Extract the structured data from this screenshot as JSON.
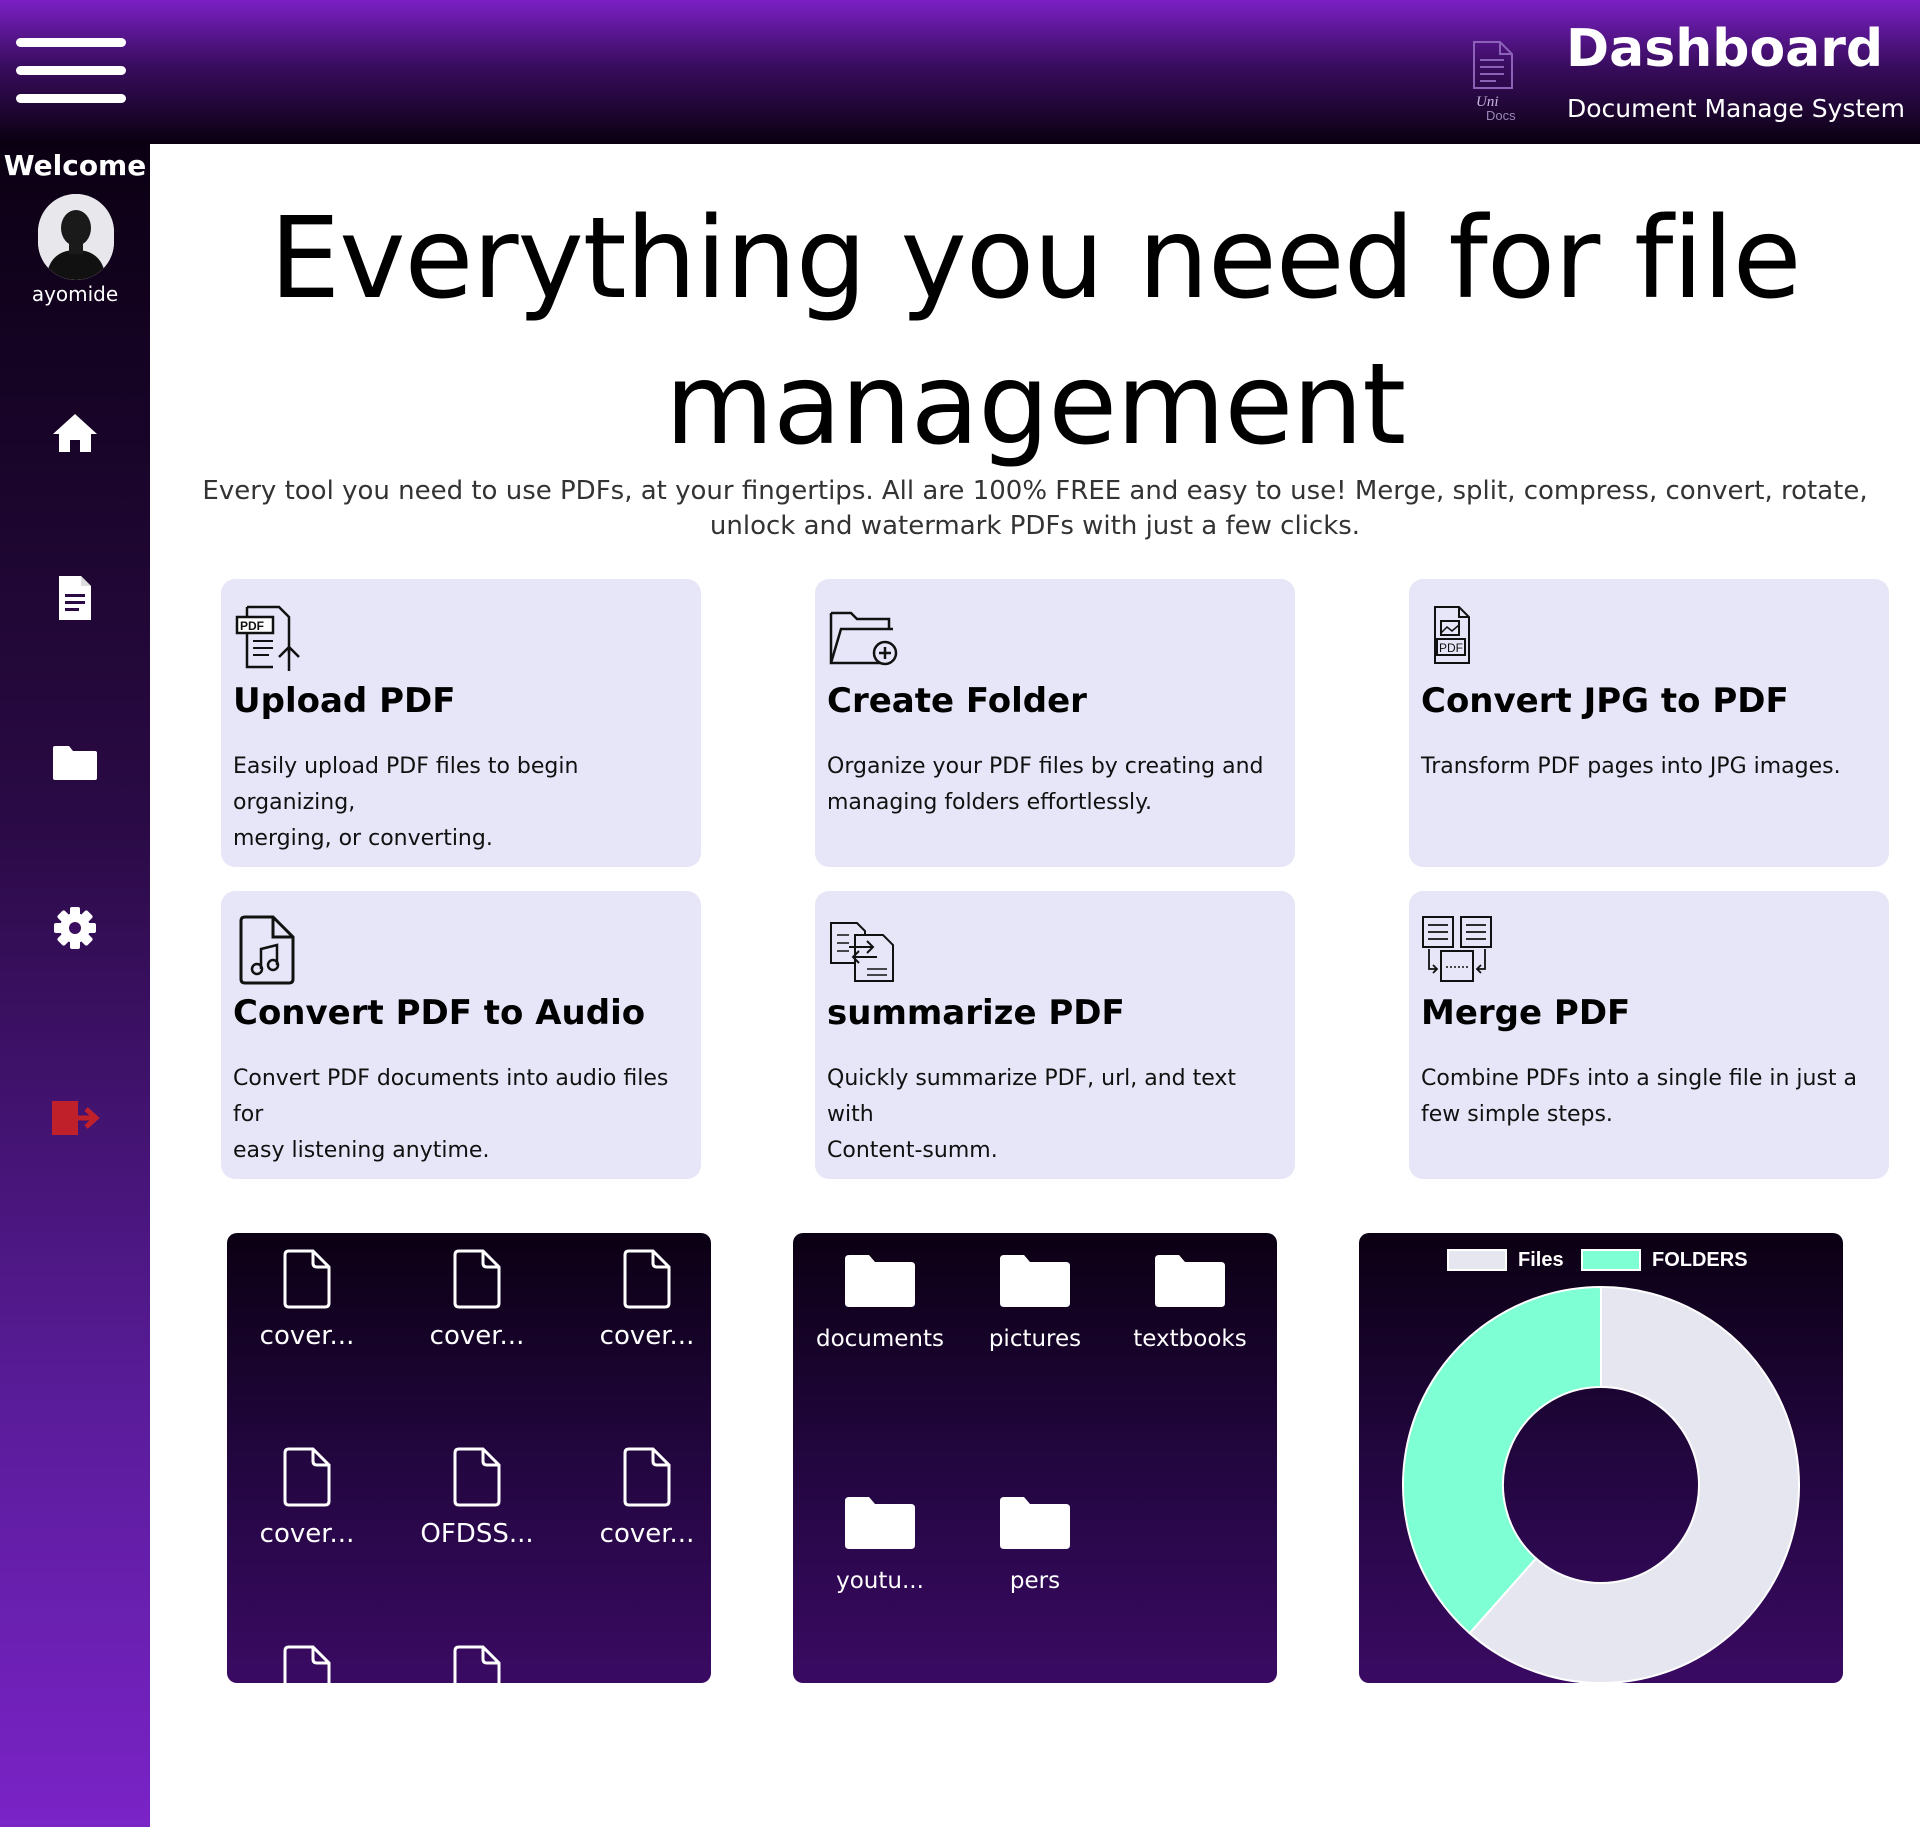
{
  "header": {
    "title": "Dashboard",
    "subtitle": "Document Manage System",
    "logo_text_top": "Uni",
    "logo_text_bottom": "Docs"
  },
  "sidebar": {
    "welcome": "Welcome",
    "username": "ayomide",
    "nav": [
      {
        "name": "home",
        "icon": "home-icon"
      },
      {
        "name": "documents",
        "icon": "document-icon"
      },
      {
        "name": "folders",
        "icon": "folder-icon"
      },
      {
        "name": "settings",
        "icon": "gear-icon"
      },
      {
        "name": "logout",
        "icon": "logout-icon"
      }
    ]
  },
  "hero": {
    "title_line1": "Everything you need for file",
    "title_line2": "management",
    "description_line1": "Every tool you need to use PDFs, at your fingertips. All are 100% FREE and easy to use! Merge, split, compress, convert, rotate,",
    "description_line2": "unlock and watermark PDFs with just a few clicks."
  },
  "cards": [
    {
      "title": "Upload PDF",
      "line1": "Easily upload PDF files to begin organizing,",
      "line2": "merging, or converting.",
      "icon": "upload-pdf-icon"
    },
    {
      "title": "Create Folder",
      "line1": "Organize your PDF files by creating and",
      "line2": "managing folders effortlessly.",
      "icon": "create-folder-icon"
    },
    {
      "title": "Convert JPG to PDF",
      "line1": "Transform PDF pages into JPG images.",
      "line2": "",
      "icon": "jpg-to-pdf-icon"
    },
    {
      "title": "Convert PDF to Audio",
      "line1": "Convert PDF documents into audio files for",
      "line2": "easy listening anytime.",
      "icon": "audio-file-icon"
    },
    {
      "title": "summarize PDF",
      "line1": "Quickly summarize PDF, url, and text with",
      "line2": "Content-summ.",
      "icon": "summarize-icon"
    },
    {
      "title": "Merge PDF",
      "line1": "Combine PDFs into a single file in just a",
      "line2": "few simple steps.",
      "icon": "merge-pdf-icon"
    }
  ],
  "files": [
    "cover...",
    "cover...",
    "cover...",
    "cover...",
    "OFDSS...",
    "cover..."
  ],
  "folders": [
    "documents",
    "pictures",
    "textbooks",
    "youtu...",
    "pers"
  ],
  "chart_data": {
    "type": "pie",
    "variant": "doughnut",
    "labels": [
      "Files",
      "FOLDERS"
    ],
    "values": [
      8,
      5
    ],
    "colors": [
      "#e6e6f0",
      "#7fffd4"
    ],
    "legend": "top"
  },
  "colors": {
    "accent_purple": "#7a20c4",
    "card_bg": "#e6e6f8",
    "logout_red": "#c0202a"
  }
}
